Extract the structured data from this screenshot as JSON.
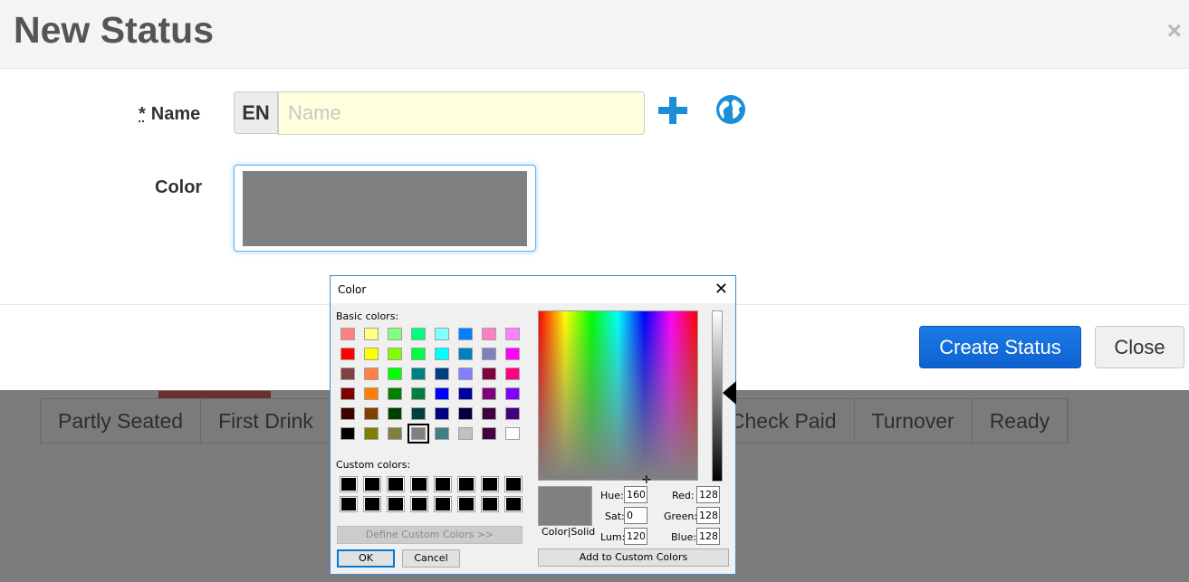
{
  "modal": {
    "title": "New Status",
    "close_glyph": "×",
    "name_label": "Name",
    "required_marker": "*",
    "lang_code": "EN",
    "name_placeholder": "Name",
    "name_value": "",
    "color_label": "Color",
    "color_value": "#808080",
    "create_button": "Create Status",
    "close_button": "Close",
    "icons": [
      "plus-icon",
      "globe-icon"
    ]
  },
  "background_tabs": [
    "Partly Seated",
    "First Drink",
    "Check Paid",
    "Turnover",
    "Ready"
  ],
  "color_dialog": {
    "title": "Color",
    "close_glyph": "✕",
    "basic_label": "Basic colors:",
    "custom_label": "Custom colors:",
    "basic_colors": [
      [
        "#ff8080",
        "#ffff80",
        "#80ff80",
        "#00ff80",
        "#80ffff",
        "#0080ff",
        "#ff80c0",
        "#ff80ff"
      ],
      [
        "#ff0000",
        "#ffff00",
        "#80ff00",
        "#00ff40",
        "#00ffff",
        "#0080c0",
        "#8080c0",
        "#ff00ff"
      ],
      [
        "#804040",
        "#ff8040",
        "#00ff00",
        "#008080",
        "#004080",
        "#8080ff",
        "#800040",
        "#ff0080"
      ],
      [
        "#800000",
        "#ff8000",
        "#008000",
        "#008040",
        "#0000ff",
        "#0000a0",
        "#800080",
        "#8000ff"
      ],
      [
        "#400000",
        "#804000",
        "#004000",
        "#004040",
        "#000080",
        "#000040",
        "#400040",
        "#400080"
      ],
      [
        "#000000",
        "#808000",
        "#808040",
        "#808080",
        "#408080",
        "#c0c0c0",
        "#400040",
        "#ffffff"
      ]
    ],
    "selected_basic": [
      5,
      3
    ],
    "custom_colors": [
      "#000000",
      "#000000",
      "#000000",
      "#000000",
      "#000000",
      "#000000",
      "#000000",
      "#000000",
      "#000000",
      "#000000",
      "#000000",
      "#000000",
      "#000000",
      "#000000",
      "#000000",
      "#000000"
    ],
    "define_button": "Define Custom Colors >>",
    "ok_button": "OK",
    "cancel_button": "Cancel",
    "preview_label": "Color|Solid",
    "add_button": "Add to Custom Colors",
    "fields": {
      "hue_label": "Hue:",
      "hue": "160",
      "sat_label": "Sat:",
      "sat": "0",
      "lum_label": "Lum:",
      "lum": "120",
      "red_label": "Red:",
      "red": "128",
      "green_label": "Green:",
      "green": "128",
      "blue_label": "Blue:",
      "blue": "128"
    }
  }
}
